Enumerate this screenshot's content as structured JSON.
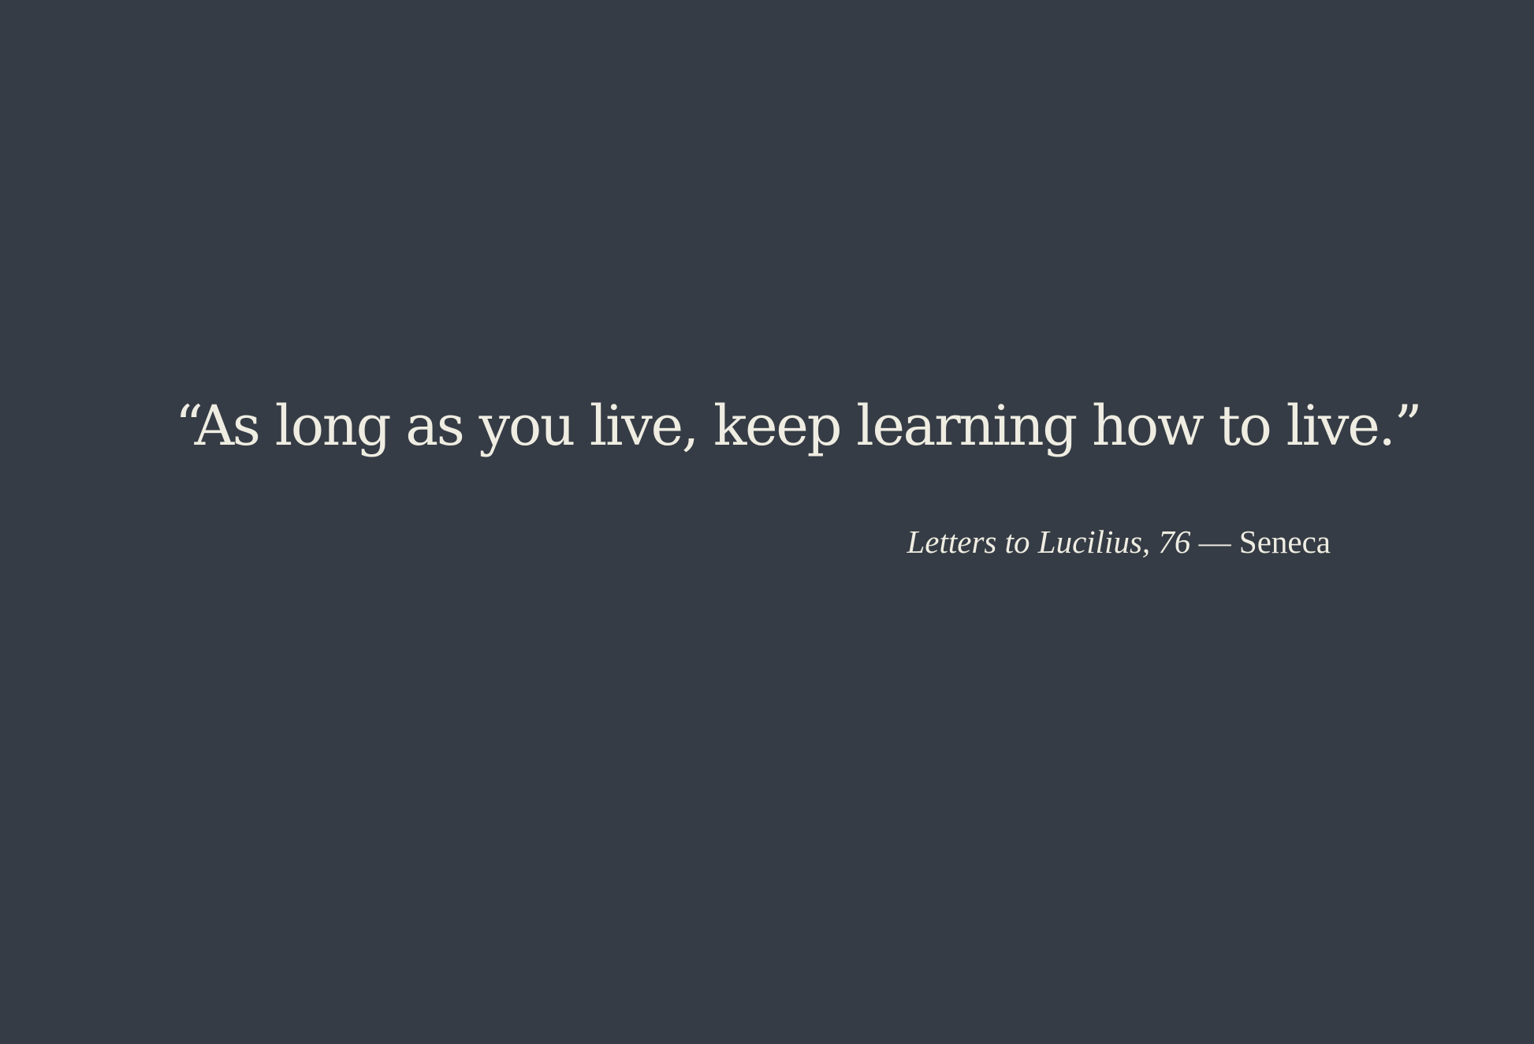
{
  "quote": {
    "text": "“As long as you live, keep learning how to live.”",
    "source": "Letters to Lucilius, 76",
    "separator": " — ",
    "author": "Seneca"
  },
  "colors": {
    "background": "#363c45",
    "text": "#efede2"
  }
}
